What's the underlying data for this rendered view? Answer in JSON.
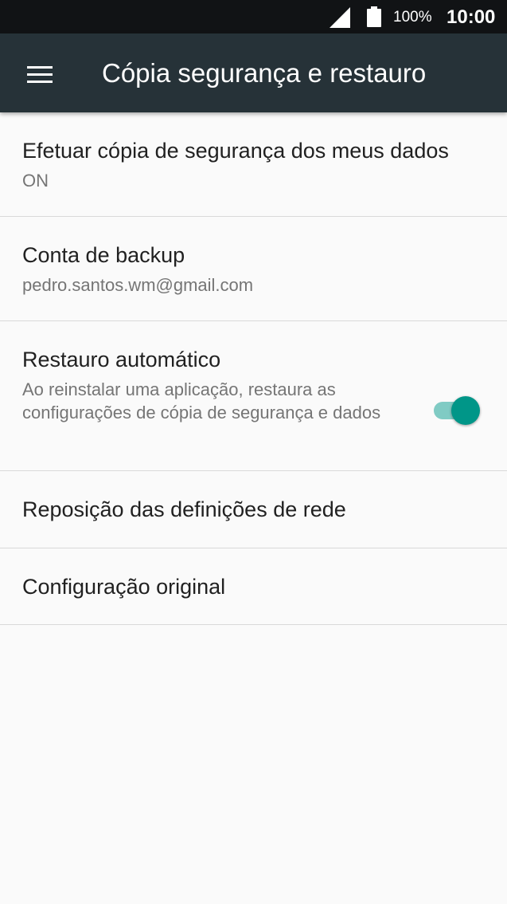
{
  "status_bar": {
    "battery": "100%",
    "time": "10:00",
    "icons": [
      "cell-signal-icon",
      "battery-icon"
    ]
  },
  "app_bar": {
    "menu_icon": "hamburger-menu-icon",
    "title": "Cópia segurança e restauro"
  },
  "settings": [
    {
      "title": "Efetuar cópia de segurança dos meus dados",
      "subtitle": "ON"
    },
    {
      "title": "Conta de backup",
      "subtitle": "pedro.santos.wm@gmail.com"
    },
    {
      "title": "Restauro automático",
      "subtitle": "Ao reinstalar uma aplicação, restaura as configurações de cópia de segurança e dados",
      "toggle_on": true
    },
    {
      "title": "Reposição das definições de rede"
    },
    {
      "title": "Configuração original"
    }
  ],
  "colors": {
    "status_bar": "#111315",
    "app_bar": "#263238",
    "background": "#fafafa",
    "accent": "#009688",
    "toggle_track": "#80cbc4"
  }
}
